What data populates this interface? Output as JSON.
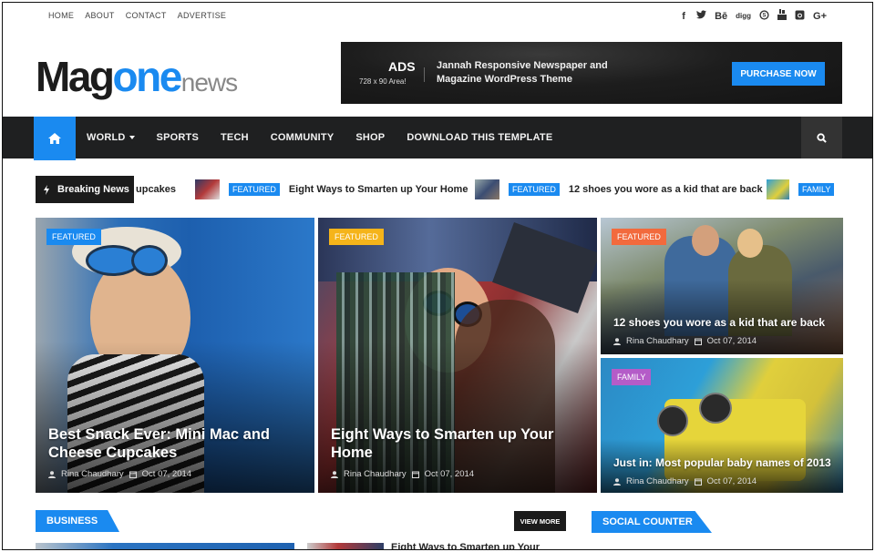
{
  "topbar": {
    "links": [
      "HOME",
      "ABOUT",
      "CONTACT",
      "ADVERTISE"
    ],
    "social_icons": [
      {
        "name": "facebook-icon",
        "glyph": "f"
      },
      {
        "name": "twitter-icon",
        "glyph": "t"
      },
      {
        "name": "behance-icon",
        "glyph": "Bē"
      },
      {
        "name": "digg-icon",
        "glyph": "digg"
      },
      {
        "name": "skype-icon",
        "glyph": "S"
      },
      {
        "name": "youtube-icon",
        "glyph": "▶"
      },
      {
        "name": "instagram-icon",
        "glyph": "◙"
      },
      {
        "name": "google-plus-icon",
        "glyph": "G+"
      }
    ]
  },
  "header": {
    "logo": {
      "part1": "Mag",
      "part2": "one",
      "part3": "news"
    },
    "ad": {
      "title": "ADS",
      "subtitle": "728 x 90 Area!",
      "text_line1": "Jannah Responsive Newspaper and",
      "text_line2": "Magazine WordPress Theme",
      "button": "PURCHASE NOW"
    }
  },
  "nav": {
    "items": [
      "WORLD",
      "SPORTS",
      "TECH",
      "COMMUNITY",
      "SHOP",
      "DOWNLOAD THIS TEMPLATE"
    ]
  },
  "ticker": {
    "label": "Breaking News",
    "items": [
      {
        "tag": "",
        "text": "upcakes"
      },
      {
        "tag": "FEATURED",
        "text": "Eight Ways to Smarten up Your Home"
      },
      {
        "tag": "FEATURED",
        "text": "12 shoes you wore as a kid that are back"
      },
      {
        "tag": "FAMILY",
        "text": ""
      }
    ]
  },
  "cards": [
    {
      "badge": "FEATURED",
      "badge_color": "#1a8af0",
      "title": "Best Snack Ever: Mini Mac and Cheese Cupcakes",
      "author": "Rina Chaudhary",
      "date": "Oct 07, 2014"
    },
    {
      "badge": "FEATURED",
      "badge_color": "#f5b41a",
      "title": "Eight Ways to Smarten up Your Home",
      "author": "Rina Chaudhary",
      "date": "Oct 07, 2014"
    },
    {
      "badge": "FEATURED",
      "badge_color": "#f26a3d",
      "title": "12 shoes you wore as a kid that are back",
      "author": "Rina Chaudhary",
      "date": "Oct 07, 2014"
    },
    {
      "badge": "FAMILY",
      "badge_color": "#b45cc8",
      "title": "Just in: Most popular baby names of 2013",
      "author": "Rina Chaudhary",
      "date": "Oct 07, 2014"
    }
  ],
  "sections": {
    "business": "BUSINESS",
    "view_more": "VIEW MORE",
    "social_counter": "SOCIAL COUNTER",
    "business_item_title": "Eight Ways to Smarten up Your"
  },
  "colors": {
    "accent": "#1a8af0",
    "nav_bg": "#1f2021"
  }
}
